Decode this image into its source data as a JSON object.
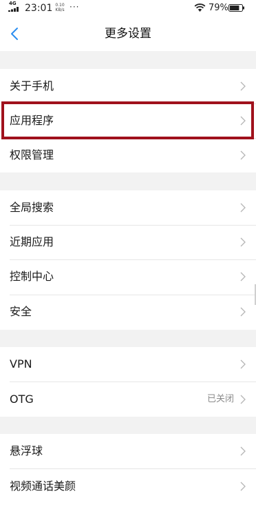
{
  "status_bar": {
    "network": "4G",
    "time": "23:01",
    "speed_value": "0.10",
    "speed_unit": "KB/s",
    "overflow": "···",
    "battery_percent": "79%",
    "battery_level": 0.79,
    "icons": [
      "signal-icon",
      "wifi-icon",
      "battery-icon"
    ]
  },
  "nav": {
    "title": "更多设置",
    "back_icon": "back-chevron-icon"
  },
  "groups": [
    {
      "items": [
        {
          "label": "关于手机",
          "value": ""
        },
        {
          "label": "应用程序",
          "value": ""
        },
        {
          "label": "权限管理",
          "value": ""
        }
      ]
    },
    {
      "items": [
        {
          "label": "全局搜索",
          "value": ""
        },
        {
          "label": "近期应用",
          "value": ""
        },
        {
          "label": "控制中心",
          "value": ""
        },
        {
          "label": "安全",
          "value": ""
        }
      ]
    },
    {
      "items": [
        {
          "label": "VPN",
          "value": ""
        },
        {
          "label": "OTG",
          "value": "已关闭"
        }
      ]
    },
    {
      "items": [
        {
          "label": "悬浮球",
          "value": ""
        },
        {
          "label": "视频通话美颜",
          "value": ""
        }
      ]
    }
  ],
  "colors": {
    "accent": "#2a8ef0",
    "highlight": "#a0111c",
    "background": "#f2f2f2"
  }
}
